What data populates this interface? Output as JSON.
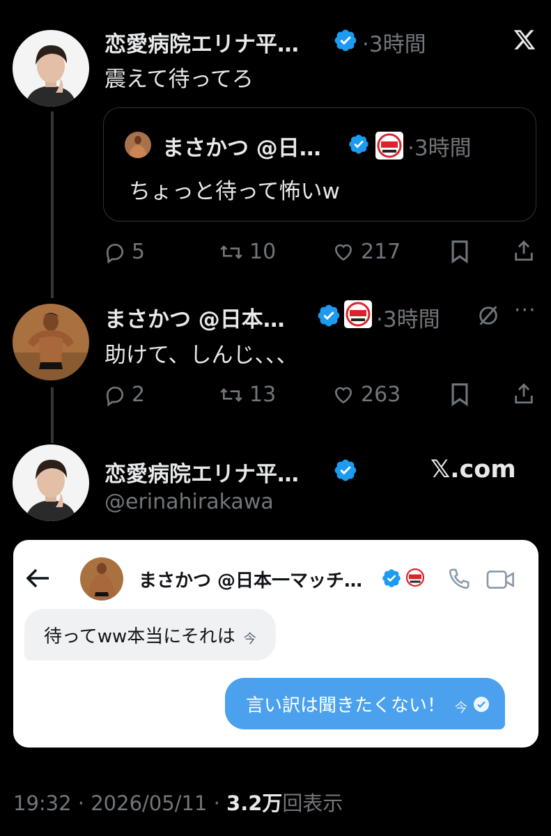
{
  "tweet1": {
    "author_name": "恋愛病院エリナ平…",
    "time": "3時間",
    "text": "震えて待ってろ",
    "quote": {
      "author_name": "まさかつ @日…",
      "time": "3時間",
      "text": "ちょっと待って怖いw"
    },
    "actions": {
      "replies": "5",
      "reposts": "10",
      "likes": "217"
    }
  },
  "tweet2": {
    "author_name": "まさかつ @日本…",
    "time": "3時間",
    "text": "助けて、しんじ、、、",
    "actions": {
      "replies": "2",
      "reposts": "13",
      "likes": "263"
    }
  },
  "tweet3": {
    "author_name": "恋愛病院エリナ平…",
    "handle": "@erinahirakawa",
    "watermark": "𝕏.com"
  },
  "dm": {
    "contact_name": "まさかつ @日本一マッチ…",
    "received_message": "待ってww本当にそれは",
    "received_time": "今",
    "sent_message": "言い訳は聞きたくない！",
    "sent_time": "今"
  },
  "footer": {
    "timestamp": "19:32 · 2026/05/11 · ",
    "views": "3.2万",
    "views_label": "回表示"
  },
  "colors": {
    "background": "#000000",
    "verified_blue": "#1d9bf0",
    "sent_bubble": "#4ba1ed",
    "received_bubble": "#eff1f3",
    "muted_text": "#71767b"
  },
  "icons": [
    "x-logo-icon",
    "verified-icon",
    "reply-icon",
    "repost-icon",
    "like-icon",
    "bookmark-icon",
    "share-icon",
    "mute-icon",
    "more-icon",
    "back-arrow-icon",
    "phone-icon",
    "video-icon",
    "read-check-icon"
  ]
}
